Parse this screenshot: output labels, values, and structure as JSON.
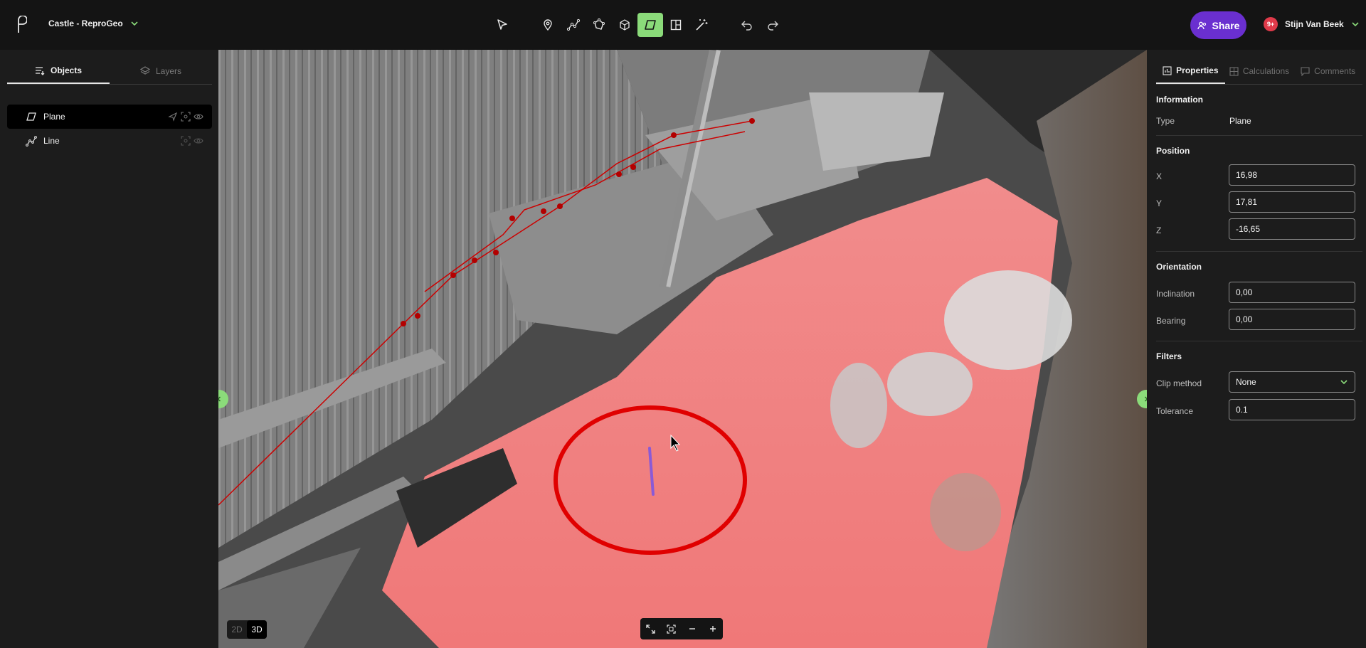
{
  "header": {
    "project_name": "Castle - ReproGeo",
    "share_label": "Share",
    "notification_count": "9+",
    "user_name": "Stijn Van Beek"
  },
  "toolbar": {
    "tools": [
      "select-cursor",
      "point-marker",
      "polyline",
      "polygon",
      "box",
      "plane",
      "section",
      "magic-wand",
      "undo",
      "redo"
    ],
    "active_tool": "plane",
    "accent": "#8bdb7a"
  },
  "left_panel": {
    "tabs": [
      {
        "label": "Objects",
        "active": true
      },
      {
        "label": "Layers",
        "active": false
      }
    ],
    "items": [
      {
        "label": "Plane",
        "type": "plane",
        "selected": true
      },
      {
        "label": "Line",
        "type": "line",
        "selected": false
      }
    ]
  },
  "viewport": {
    "view_modes": [
      "2D",
      "3D"
    ],
    "active_mode": "3D"
  },
  "right_panel": {
    "tabs": [
      {
        "label": "Properties",
        "active": true
      },
      {
        "label": "Calculations",
        "active": false
      },
      {
        "label": "Comments",
        "active": false
      }
    ],
    "information": {
      "title": "Information",
      "type_label": "Type",
      "type_value": "Plane"
    },
    "position": {
      "title": "Position",
      "x_label": "X",
      "x_value": "16,98",
      "y_label": "Y",
      "y_value": "17,81",
      "z_label": "Z",
      "z_value": "-16,65"
    },
    "orientation": {
      "title": "Orientation",
      "inclination_label": "Inclination",
      "inclination_value": "0,00",
      "bearing_label": "Bearing",
      "bearing_value": "0,00"
    },
    "filters": {
      "title": "Filters",
      "clip_label": "Clip method",
      "clip_value": "None",
      "tolerance_label": "Tolerance",
      "tolerance_value": "0.1"
    }
  },
  "colors": {
    "share_button": "#6a2fd0",
    "plane_overlay": "#f08080",
    "annotation_circle": "#e00000",
    "line_object": "#cc0000"
  }
}
